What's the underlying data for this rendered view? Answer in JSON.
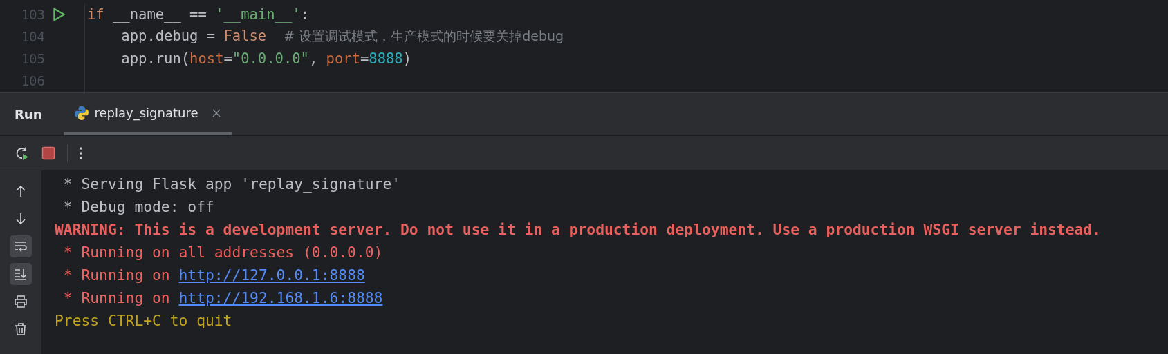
{
  "editor": {
    "lines": [
      {
        "number": "103",
        "run_marker": true,
        "tokens": [
          {
            "kind": "keyword",
            "text": "if"
          },
          {
            "kind": "plain",
            "text": " __name__ == "
          },
          {
            "kind": "string",
            "text": "'__main__'"
          },
          {
            "kind": "plain",
            "text": ":"
          }
        ]
      },
      {
        "number": "104",
        "run_marker": false,
        "tokens": [
          {
            "kind": "plain",
            "text": "    app.debug = "
          },
          {
            "kind": "keyword",
            "text": "False"
          },
          {
            "kind": "comment",
            "text": "# 设置调试模式，生产模式的时候要关掉debug"
          }
        ]
      },
      {
        "number": "105",
        "run_marker": false,
        "tokens": [
          {
            "kind": "plain",
            "text": "    app.run("
          },
          {
            "kind": "param",
            "text": "host"
          },
          {
            "kind": "plain",
            "text": "="
          },
          {
            "kind": "string",
            "text": "\"0.0.0.0\""
          },
          {
            "kind": "plain",
            "text": ", "
          },
          {
            "kind": "param",
            "text": "port"
          },
          {
            "kind": "plain",
            "text": "="
          },
          {
            "kind": "number",
            "text": "8888"
          },
          {
            "kind": "plain",
            "text": ")"
          }
        ]
      },
      {
        "number": "106",
        "run_marker": false
      }
    ]
  },
  "run_panel": {
    "title": "Run",
    "tabs": [
      {
        "label": "replay_signature",
        "selected": true
      }
    ],
    "toolbar": [
      {
        "kind": "rerun"
      },
      {
        "kind": "stop"
      },
      {
        "kind": "divider"
      },
      {
        "kind": "more"
      }
    ],
    "sidebar": [
      {
        "kind": "up",
        "on": false
      },
      {
        "kind": "down",
        "on": false
      },
      {
        "kind": "wrap",
        "on": true
      },
      {
        "kind": "scroll-end",
        "on": true
      },
      {
        "kind": "print",
        "on": false
      },
      {
        "kind": "trash",
        "on": false
      }
    ],
    "console": [
      [
        {
          "kind": "normal",
          "text": " * Serving Flask app 'replay_signature'"
        }
      ],
      [
        {
          "kind": "normal",
          "text": " * Debug mode: off"
        }
      ],
      [
        {
          "kind": "error-bold",
          "text": "WARNING: This is a development server. Do not use it in a production deployment. Use a production WSGI server instead."
        }
      ],
      [
        {
          "kind": "error",
          "text": " * Running on all addresses (0.0.0.0)"
        }
      ],
      [
        {
          "kind": "error",
          "text": " * Running on "
        },
        {
          "kind": "link",
          "text": "http://127.0.0.1:8888"
        }
      ],
      [
        {
          "kind": "error",
          "text": " * Running on "
        },
        {
          "kind": "link",
          "text": "http://192.168.1.6:8888"
        }
      ],
      [
        {
          "kind": "warning",
          "text": "Press CTRL+C to quit"
        }
      ]
    ]
  }
}
